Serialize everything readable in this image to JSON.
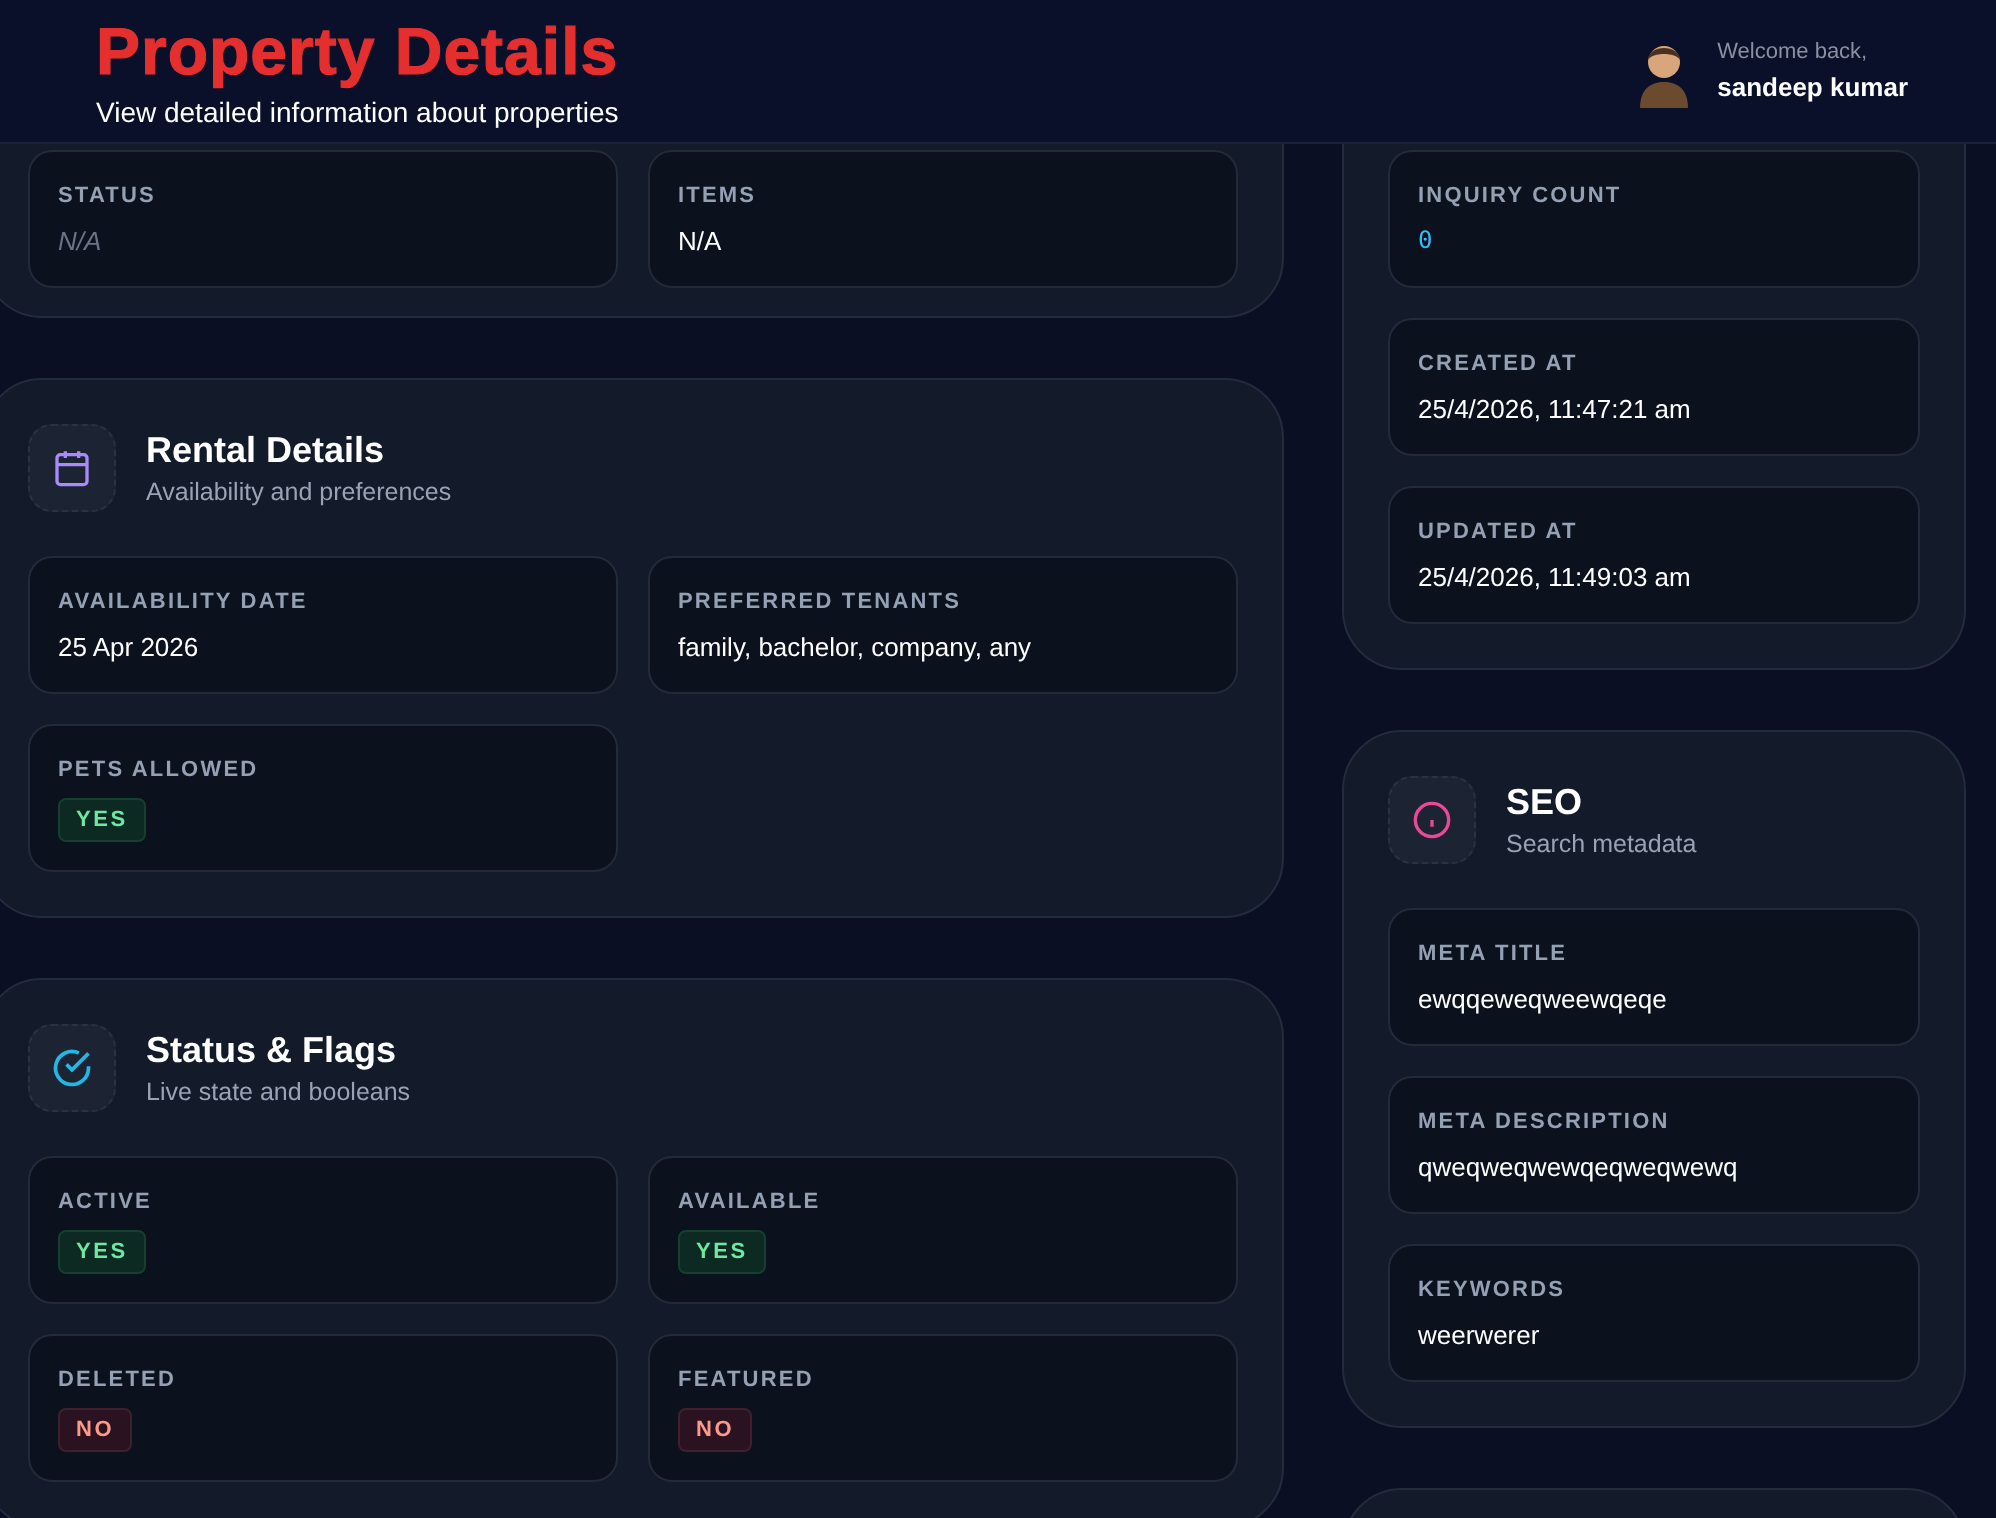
{
  "header": {
    "title": "Property Details",
    "subtitle": "View detailed information about properties",
    "welcome": "Welcome back,",
    "user_name": "sandeep kumar"
  },
  "left_sections": [
    {
      "fields": [
        {
          "label": "STATUS",
          "value": "N/A",
          "kind": "na"
        },
        {
          "label": "ITEMS",
          "value": "N/A",
          "kind": "text"
        }
      ]
    },
    {
      "title": "Rental Details",
      "subtitle": "Availability and preferences",
      "fields": [
        {
          "label": "AVAILABILITY DATE",
          "value": "25 Apr 2026",
          "kind": "text"
        },
        {
          "label": "PREFERRED TENANTS",
          "value": "family, bachelor, company, any",
          "kind": "text"
        },
        {
          "label": "PETS ALLOWED",
          "value": "YES",
          "kind": "flag",
          "on": true
        }
      ]
    },
    {
      "title": "Status & Flags",
      "subtitle": "Live state and booleans",
      "fields": [
        {
          "label": "ACTIVE",
          "value": "YES",
          "kind": "flag",
          "on": true
        },
        {
          "label": "AVAILABLE",
          "value": "YES",
          "kind": "flag",
          "on": true
        },
        {
          "label": "DELETED",
          "value": "NO",
          "kind": "flag",
          "on": false
        },
        {
          "label": "FEATURED",
          "value": "NO",
          "kind": "flag",
          "on": false
        }
      ]
    }
  ],
  "right_sections": [
    {
      "fields": [
        {
          "label": "INQUIRY COUNT",
          "value": "0",
          "kind": "mono"
        },
        {
          "label": "CREATED AT",
          "value": "25/4/2026, 11:47:21 am",
          "kind": "text"
        },
        {
          "label": "UPDATED AT",
          "value": "25/4/2026, 11:49:03 am",
          "kind": "text"
        }
      ]
    },
    {
      "title": "SEO",
      "subtitle": "Search metadata",
      "fields": [
        {
          "label": "META TITLE",
          "value": "ewqqeweqweewqeqe",
          "kind": "text"
        },
        {
          "label": "META DESCRIPTION",
          "value": "qweqweqwewqeqweqwewq",
          "kind": "text"
        },
        {
          "label": "KEYWORDS",
          "value": "weerwerer",
          "kind": "text"
        }
      ]
    }
  ]
}
